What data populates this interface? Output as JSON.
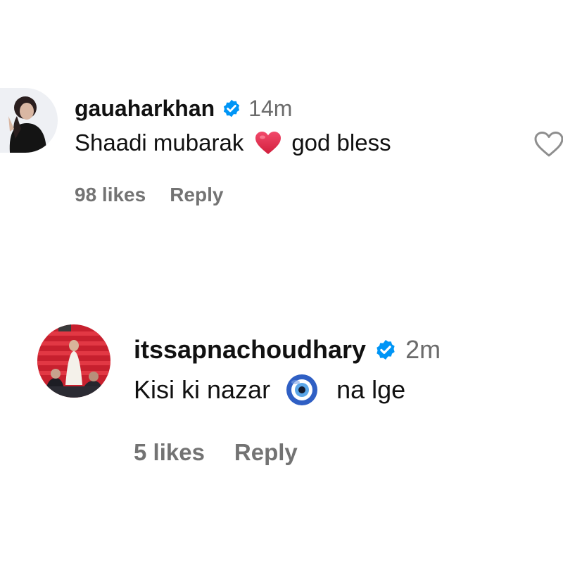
{
  "comments": [
    {
      "username": "gauaharkhan",
      "verified": true,
      "time": "14m",
      "text_before_emoji": "Shaadi mubarak",
      "emoji": "heart-emoji",
      "text_after_emoji": "god bless",
      "likes": "98 likes",
      "reply_label": "Reply"
    },
    {
      "username": "itssapnachoudhary",
      "verified": true,
      "time": "2m",
      "text_before_emoji": "Kisi ki nazar",
      "emoji": "nazar-evil-eye-emoji",
      "text_after_emoji": "na lge",
      "likes": "5 likes",
      "reply_label": "Reply"
    }
  ],
  "colors": {
    "verified_badge": "#0095f6",
    "secondary_text": "#737373",
    "heart_emoji": "#e8344e"
  }
}
